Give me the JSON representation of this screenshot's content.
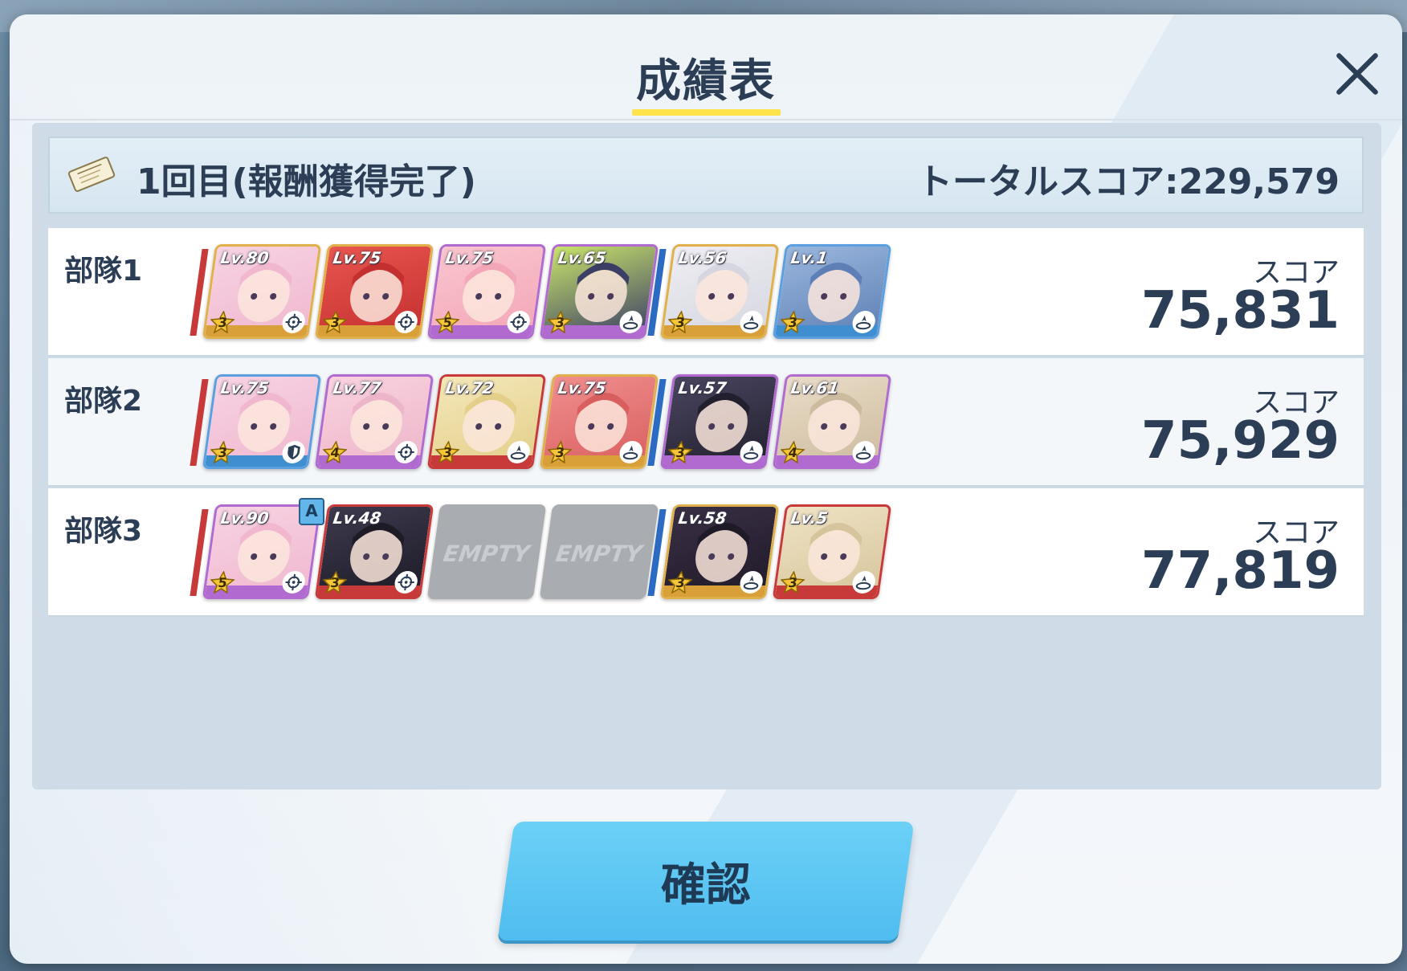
{
  "dialog": {
    "title": "成績表",
    "attempt_label": "1回目(報酬獲得完了)",
    "total_score": "トータルスコア:229,579",
    "confirm_label": "確認"
  },
  "squads": [
    {
      "label": "部隊1",
      "score_label": "スコア",
      "score": "75,831",
      "cards": [
        {
          "level": "Lv.80",
          "stars": "3",
          "role": "crosshair-icon",
          "border": "gold",
          "art": [
            "#f7d3e2",
            "#f0b7cf"
          ],
          "strip": "#d9a03a"
        },
        {
          "level": "Lv.75",
          "stars": "3",
          "role": "crosshair-icon",
          "border": "gold",
          "art": [
            "#e8564f",
            "#c42f2f"
          ],
          "strip": "#d9a03a"
        },
        {
          "level": "Lv.75",
          "stars": "5",
          "role": "crosshair-icon",
          "border": "purple",
          "art": [
            "#f9c5cf",
            "#f3a6b6"
          ],
          "strip": "#b06ad0"
        },
        {
          "level": "Lv.65",
          "stars": "3",
          "role": "healer-icon",
          "border": "purple",
          "art": [
            "#c8e36a",
            "#3b3f66"
          ],
          "strip": "#b06ad0"
        },
        {
          "level": "Lv.56",
          "stars": "3",
          "role": "healer-icon",
          "border": "gold",
          "art": [
            "#eeeef3",
            "#d5d6df"
          ],
          "strip": "#d9a03a"
        },
        {
          "level": "Lv.1",
          "stars": "3",
          "role": "healer-icon",
          "border": "blue",
          "art": [
            "#9ab7dd",
            "#5d7fb5"
          ],
          "strip": "#3f8fd0"
        }
      ]
    },
    {
      "label": "部隊2",
      "score_label": "スコア",
      "score": "75,929",
      "cards": [
        {
          "level": "Lv.75",
          "stars": "3",
          "role": "shield-icon",
          "border": "blue",
          "art": [
            "#f7d3e2",
            "#f0b7cf"
          ],
          "strip": "#3f8fd0"
        },
        {
          "level": "Lv.77",
          "stars": "4",
          "role": "crosshair-icon",
          "border": "purple",
          "art": [
            "#f9d2df",
            "#ecb5c9"
          ],
          "strip": "#b06ad0"
        },
        {
          "level": "Lv.72",
          "stars": "3",
          "role": "healer-icon",
          "border": "red",
          "art": [
            "#f4e7b8",
            "#e3cf8a"
          ],
          "strip": "#c83a3a"
        },
        {
          "level": "Lv.75",
          "stars": "3",
          "role": "healer-icon",
          "border": "gold",
          "art": [
            "#f08e8e",
            "#d95f5f"
          ],
          "strip": "#d9a03a"
        },
        {
          "level": "Lv.57",
          "stars": "3",
          "role": "healer-icon",
          "border": "purple",
          "art": [
            "#4a4560",
            "#22202e"
          ],
          "strip": "#b06ad0"
        },
        {
          "level": "Lv.61",
          "stars": "4",
          "role": "healer-icon",
          "border": "purple",
          "art": [
            "#e9dcc7",
            "#cdbb9f"
          ],
          "strip": "#b06ad0"
        }
      ]
    },
    {
      "label": "部隊3",
      "score_label": "スコア",
      "score": "77,819",
      "badge": "A",
      "cards": [
        {
          "level": "Lv.90",
          "stars": "5",
          "role": "crosshair-icon",
          "border": "purple",
          "art": [
            "#f7d3e2",
            "#f0b7cf"
          ],
          "strip": "#b06ad0"
        },
        {
          "level": "Lv.48",
          "stars": "3",
          "role": "crosshair-icon",
          "border": "red",
          "art": [
            "#3d3a4e",
            "#1c1b26"
          ],
          "strip": "#c83a3a"
        },
        {
          "empty": true,
          "label": "EMPTY"
        },
        {
          "empty": true,
          "label": "EMPTY"
        },
        {
          "level": "Lv.58",
          "stars": "3",
          "role": "healer-icon",
          "border": "gold",
          "art": [
            "#3a2f45",
            "#1f1a28"
          ],
          "strip": "#d9a03a"
        },
        {
          "level": "Lv.5",
          "stars": "3",
          "role": "healer-icon",
          "border": "red",
          "art": [
            "#efe3c4",
            "#d6c59c"
          ],
          "strip": "#c83a3a"
        }
      ]
    }
  ],
  "colors": {
    "title_underline": "#ffe34a",
    "striker_stripe": "#c83a3a",
    "special_stripe": "#2c6bc4",
    "confirm_button": "#56c3f2"
  }
}
